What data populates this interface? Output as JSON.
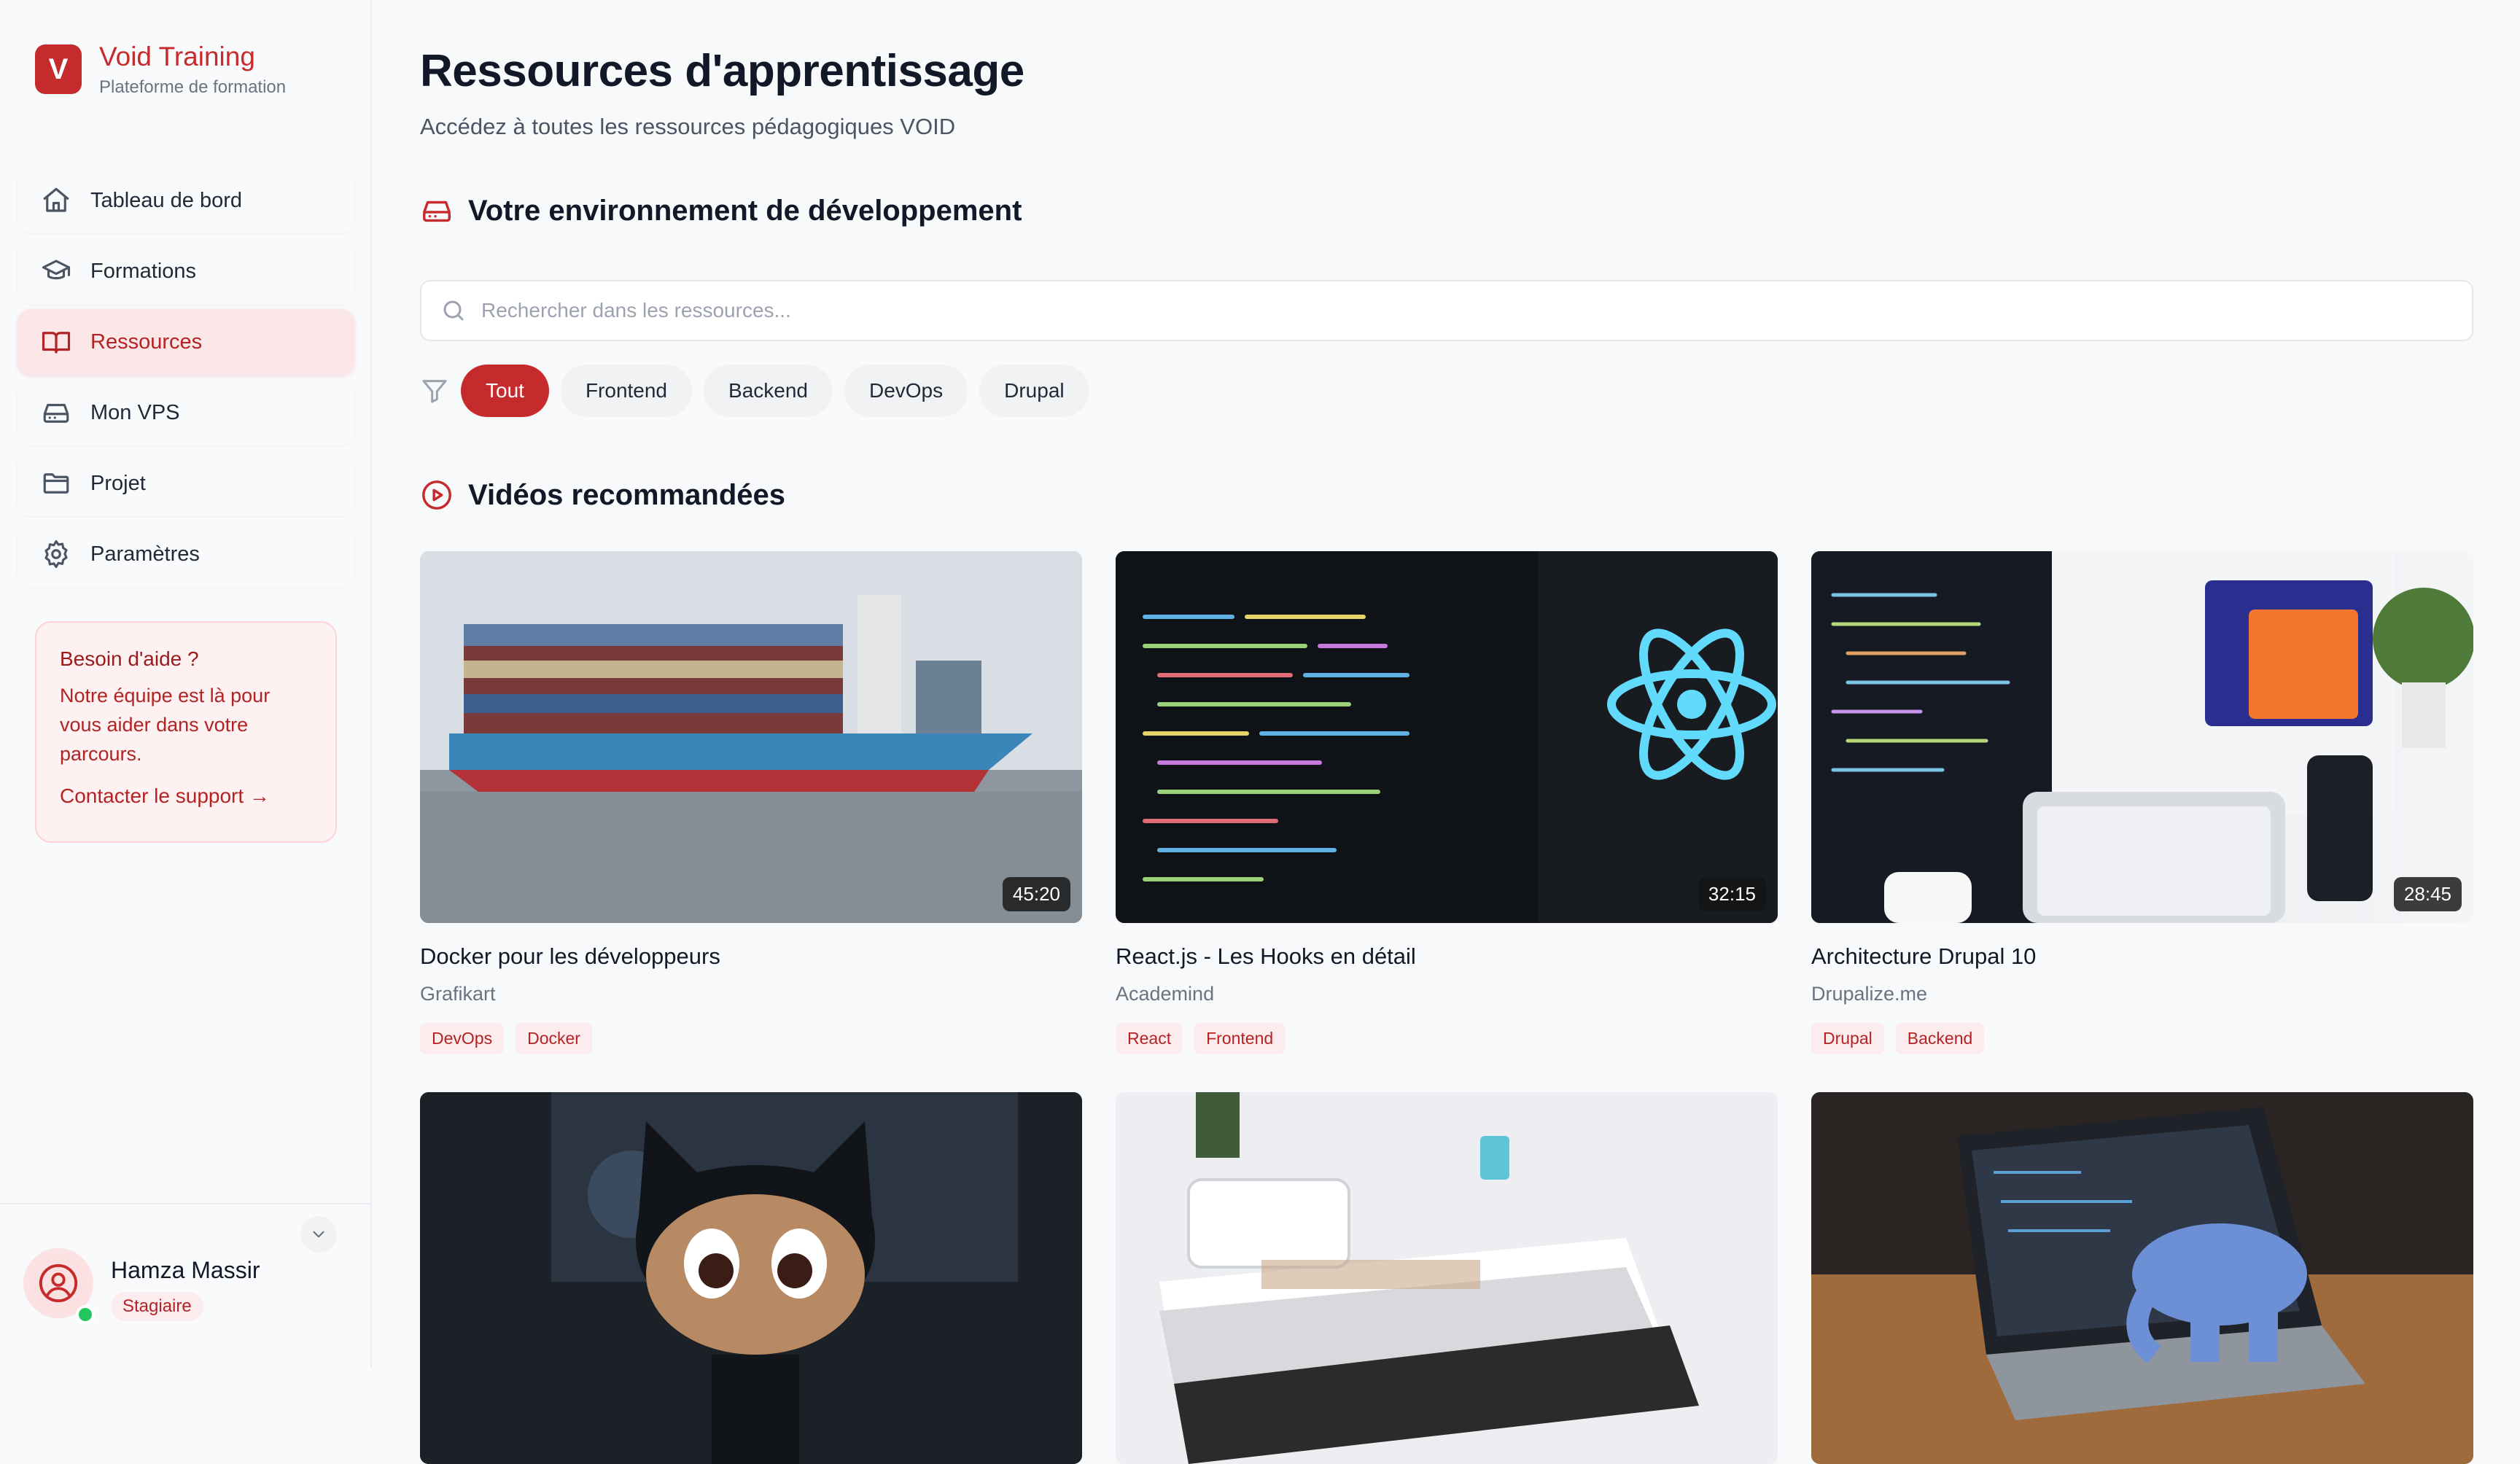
{
  "brand": {
    "logo_letter": "V",
    "title": "Void Training",
    "subtitle": "Plateforme de formation"
  },
  "nav": {
    "items": [
      {
        "label": "Tableau de bord",
        "icon": "home-icon"
      },
      {
        "label": "Formations",
        "icon": "graduation-cap-icon"
      },
      {
        "label": "Ressources",
        "icon": "book-open-icon",
        "active": true
      },
      {
        "label": "Mon VPS",
        "icon": "server-icon"
      },
      {
        "label": "Projet",
        "icon": "folder-icon"
      },
      {
        "label": "Paramètres",
        "icon": "gear-icon"
      }
    ]
  },
  "help": {
    "title": "Besoin d'aide ?",
    "text": "Notre équipe est là pour vous aider dans votre parcours.",
    "link": "Contacter le support →"
  },
  "user": {
    "name": "Hamza Massir",
    "role": "Stagiaire",
    "status": "online"
  },
  "page": {
    "title": "Ressources d'apprentissage",
    "subtitle": "Accédez à toutes les ressources pédagogiques VOID"
  },
  "env_section": {
    "title": "Votre environnement de développement"
  },
  "search": {
    "placeholder": "Rechercher dans les ressources...",
    "value": ""
  },
  "filters": [
    "Tout",
    "Frontend",
    "Backend",
    "DevOps",
    "Drupal"
  ],
  "active_filter": "Tout",
  "videos_section": {
    "title": "Vidéos recommandées"
  },
  "videos": [
    {
      "title": "Docker pour les développeurs",
      "author": "Grafikart",
      "duration": "45:20",
      "tags": [
        "DevOps",
        "Docker"
      ],
      "thumb": "container-ship"
    },
    {
      "title": "React.js - Les Hooks en détail",
      "author": "Academind",
      "duration": "32:15",
      "tags": [
        "React",
        "Frontend"
      ],
      "thumb": "react-code-screen"
    },
    {
      "title": "Architecture Drupal 10",
      "author": "Drupalize.me",
      "duration": "28:45",
      "tags": [
        "Drupal",
        "Backend"
      ],
      "thumb": "monitor-devices"
    },
    {
      "title": "",
      "author": "",
      "duration": "",
      "tags": [],
      "thumb": "octocat-figure"
    },
    {
      "title": "",
      "author": "",
      "duration": "",
      "tags": [],
      "thumb": "css-books"
    },
    {
      "title": "",
      "author": "",
      "duration": "",
      "tags": [],
      "thumb": "php-elephant-laptop"
    }
  ],
  "colors": {
    "accent": "#c52a2d",
    "accent_soft": "#fce7e8",
    "text": "#111827",
    "muted": "#6b7280",
    "online": "#22c55e"
  }
}
